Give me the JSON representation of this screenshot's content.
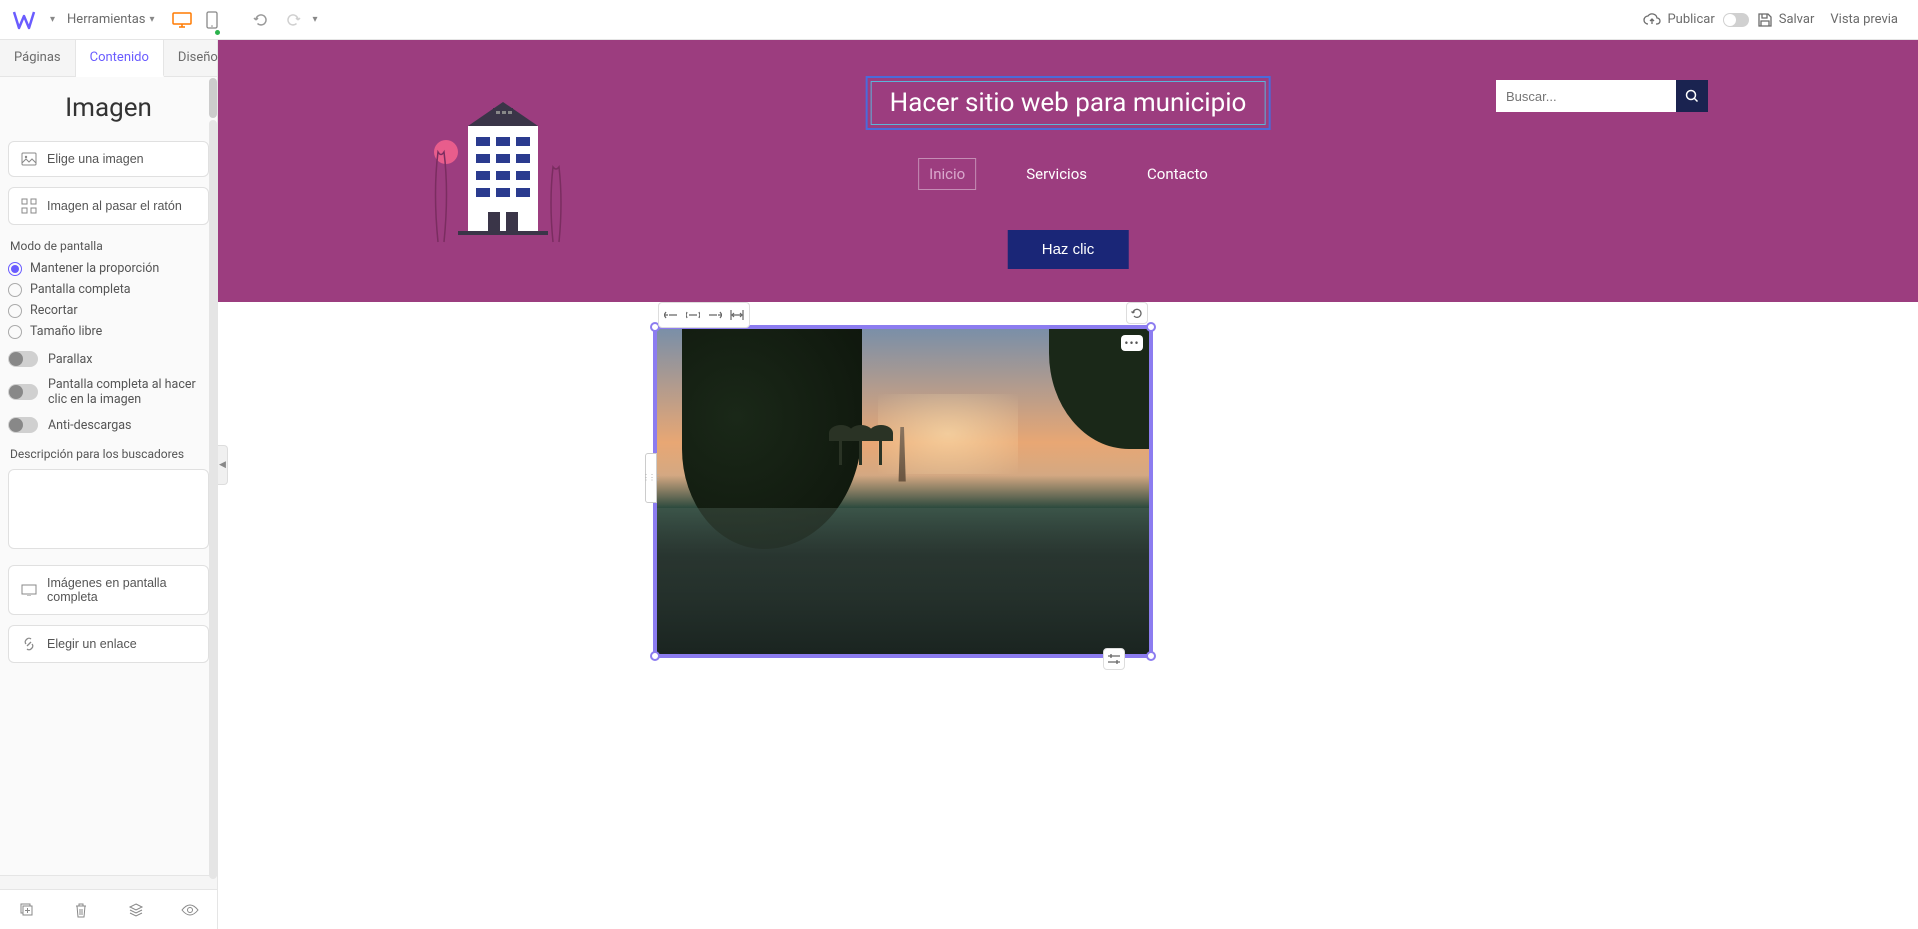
{
  "toolbar": {
    "tools_label": "Herramientas",
    "publish_label": "Publicar",
    "save_label": "Salvar",
    "preview_label": "Vista previa"
  },
  "side_tabs": {
    "pages": "Páginas",
    "content": "Contenido",
    "design": "Diseño"
  },
  "panel": {
    "title": "Imagen",
    "choose_image": "Elige una imagen",
    "hover_image": "Imagen al pasar el ratón",
    "screen_mode_label": "Modo de pantalla",
    "radio_keep_ratio": "Mantener la proporción",
    "radio_fullscreen": "Pantalla completa",
    "radio_crop": "Recortar",
    "radio_free": "Tamaño libre",
    "parallax_label": "Parallax",
    "fullscreen_click_label": "Pantalla completa al hacer clic en la imagen",
    "anti_download_label": "Anti-descargas",
    "seo_desc_label": "Descripción para los buscadores",
    "fullscreen_images": "Imágenes en pantalla completa",
    "choose_link": "Elegir un enlace"
  },
  "canvas": {
    "site_title": "Hacer sitio web para municipio",
    "search_placeholder": "Buscar...",
    "nav": {
      "home": "Inicio",
      "services": "Servicios",
      "contact": "Contacto"
    },
    "cta": "Haz clic"
  }
}
